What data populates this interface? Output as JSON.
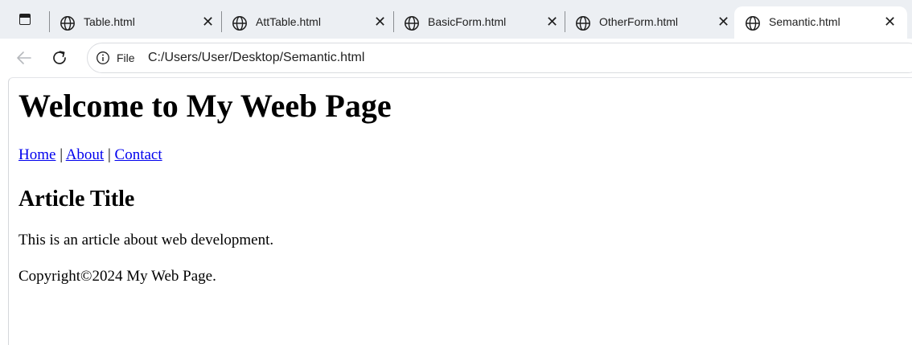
{
  "browser": {
    "tabs": [
      {
        "title": "Table.html",
        "active": false
      },
      {
        "title": "AttTable.html",
        "active": false
      },
      {
        "title": "BasicForm.html",
        "active": false
      },
      {
        "title": "OtherForm.html",
        "active": false
      },
      {
        "title": "Semantic.html",
        "active": true
      }
    ],
    "close_glyph": "✕",
    "address": {
      "scheme_label": "File",
      "url": "C:/Users/User/Desktop/Semantic.html"
    },
    "icons": {
      "tab_strip_toggle": "vertical-tabs-icon",
      "tab": "globe-icon",
      "back": "back-arrow-icon",
      "reload": "reload-icon",
      "info": "info-icon"
    }
  },
  "page": {
    "heading": "Welcome to My Weeb Page",
    "nav": {
      "links": [
        "Home",
        "About",
        "Contact"
      ],
      "separator": "|"
    },
    "article_title": "Article Title",
    "article_text": "This is an article about web development.",
    "footer_text": "Copyright©2024 My Web Page.",
    "link_color": "#0000ee"
  }
}
